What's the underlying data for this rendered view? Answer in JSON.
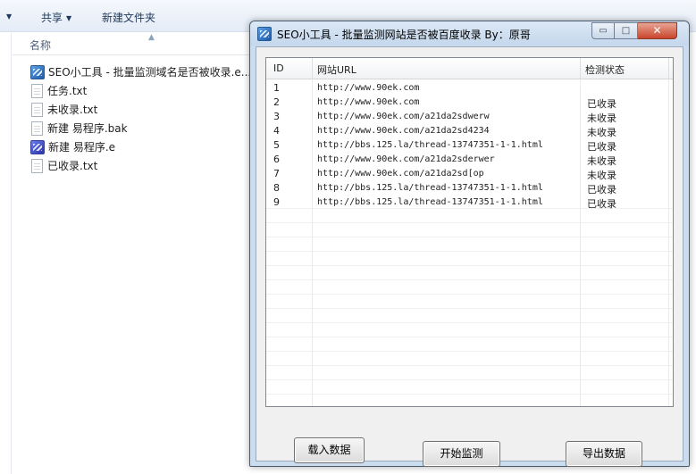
{
  "explorer": {
    "toolbar": {
      "share_label": "共享",
      "new_folder_label": "新建文件夹"
    },
    "column_name": "名称",
    "files": [
      {
        "name": "SEO小工具 - 批量监测域名是否被收录.e...",
        "icon": "app-icon"
      },
      {
        "name": "任务.txt",
        "icon": "text-file-icon"
      },
      {
        "name": "未收录.txt",
        "icon": "text-file-icon"
      },
      {
        "name": "新建 易程序.bak",
        "icon": "text-file-icon"
      },
      {
        "name": "新建 易程序.e",
        "icon": "e-source-icon"
      },
      {
        "name": "已收录.txt",
        "icon": "text-file-icon"
      }
    ]
  },
  "window": {
    "title": "SEO小工具 - 批量监测网站是否被百度收录   By：原哥",
    "controls": {
      "minimize": "▭",
      "maximize": "□",
      "close": "✕"
    }
  },
  "list": {
    "columns": [
      "ID",
      "网站URL",
      "检测状态"
    ],
    "rows": [
      {
        "id": "1",
        "url": "http://www.90ek.com",
        "status": ""
      },
      {
        "id": "2",
        "url": "http://www.90ek.com",
        "status": "已收录"
      },
      {
        "id": "3",
        "url": "http://www.90ek.com/a21da2sdwerw",
        "status": "未收录"
      },
      {
        "id": "4",
        "url": "http://www.90ek.com/a21da2sd4234",
        "status": "未收录"
      },
      {
        "id": "5",
        "url": "http://bbs.125.la/thread-13747351-1-1.html",
        "status": "已收录"
      },
      {
        "id": "6",
        "url": "http://www.90ek.com/a21da2sderwer",
        "status": "未收录"
      },
      {
        "id": "7",
        "url": "http://www.90ek.com/a21da2sd[op",
        "status": "未收录"
      },
      {
        "id": "8",
        "url": "http://bbs.125.la/thread-13747351-1-1.html",
        "status": "已收录"
      },
      {
        "id": "9",
        "url": "http://bbs.125.la/thread-13747351-1-1.html",
        "status": "已收录"
      }
    ]
  },
  "buttons": {
    "load": "载入数据",
    "start": "开始监测",
    "export": "导出数据"
  }
}
